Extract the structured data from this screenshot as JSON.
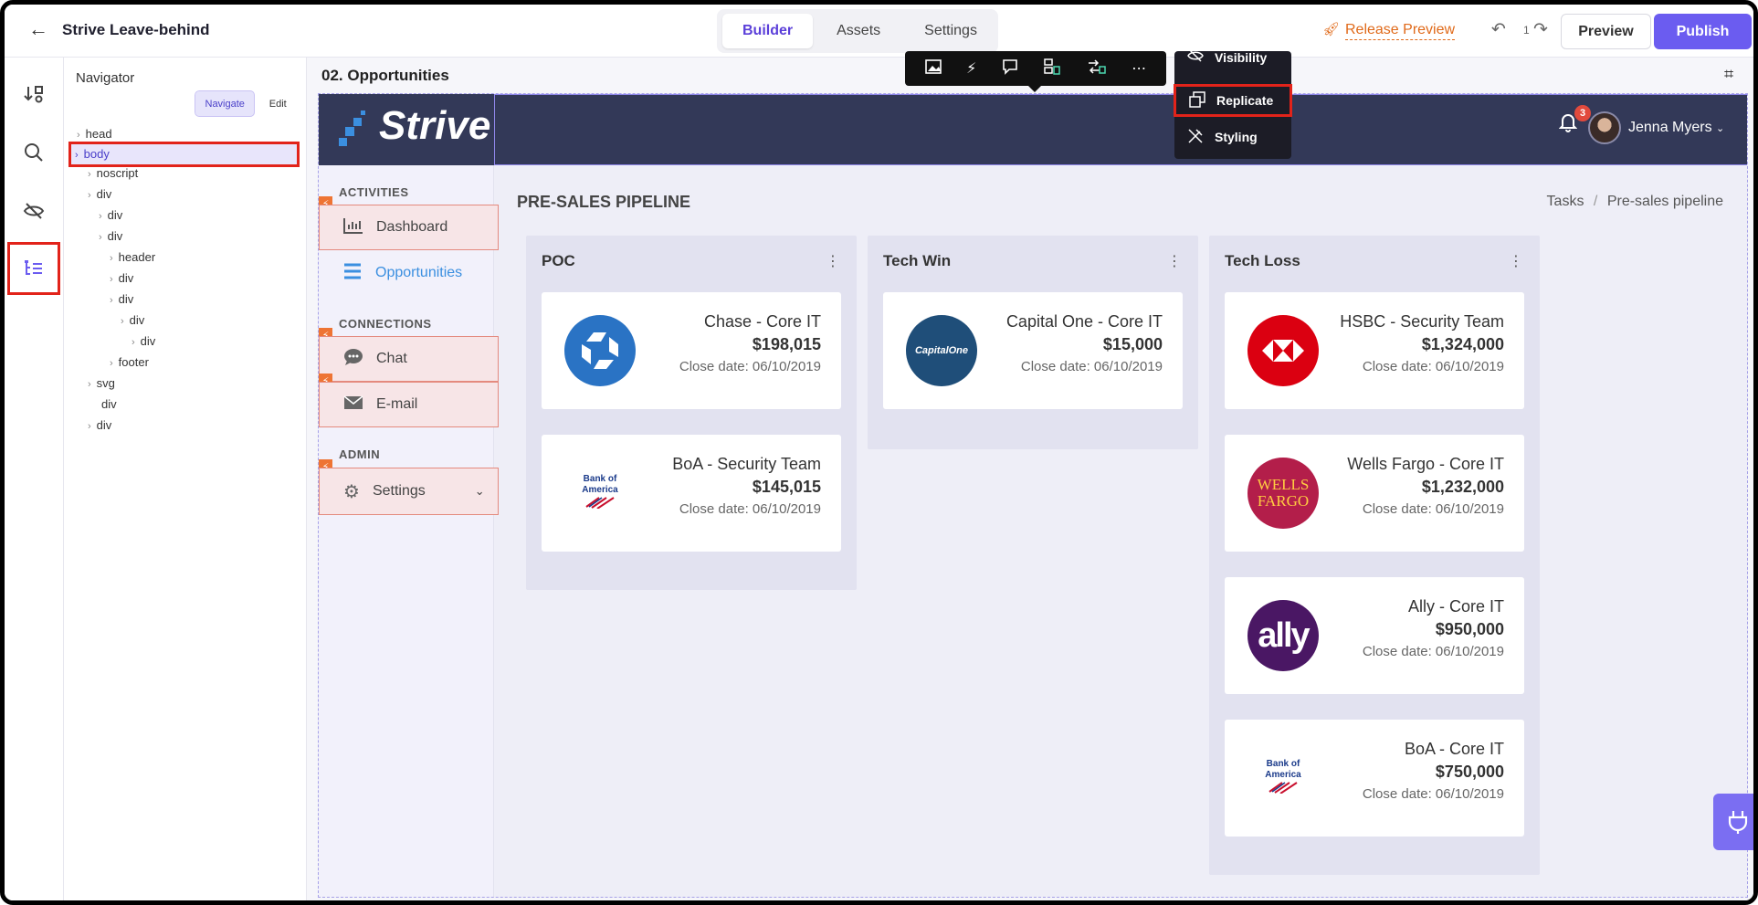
{
  "app": {
    "title": "Strive Leave-behind"
  },
  "top_tabs": [
    {
      "label": "Builder"
    },
    {
      "label": "Assets"
    },
    {
      "label": "Settings"
    }
  ],
  "toolbar": {
    "release_preview": "Release Preview",
    "history_count": "1",
    "preview_label": "Preview",
    "publish_label": "Publish"
  },
  "navigator": {
    "title": "Navigator",
    "mode_navigate": "Navigate",
    "mode_edit": "Edit",
    "tree": [
      {
        "label": "head"
      },
      {
        "label": "body"
      },
      {
        "label": "noscript"
      },
      {
        "label": "div"
      },
      {
        "label": "div"
      },
      {
        "label": "div"
      },
      {
        "label": "header"
      },
      {
        "label": "div"
      },
      {
        "label": "div"
      },
      {
        "label": "div"
      },
      {
        "label": "div"
      },
      {
        "label": "footer"
      },
      {
        "label": "svg"
      },
      {
        "label": "div"
      },
      {
        "label": "div"
      }
    ]
  },
  "canvas": {
    "page_label": "02. Opportunities"
  },
  "context_menu": {
    "visibility": "Visibility",
    "replicate": "Replicate",
    "styling": "Styling"
  },
  "site": {
    "logo_text": "Strive",
    "notifications": "3",
    "user_name": "Jenna Myers",
    "sidebar": {
      "activities": "ACTIVITIES",
      "dashboard": "Dashboard",
      "opportunities": "Opportunities",
      "connections": "CONNECTIONS",
      "chat": "Chat",
      "email": "E-mail",
      "admin": "ADMIN",
      "settings": "Settings"
    },
    "title": "PRE-SALES PIPELINE",
    "breadcrumb": {
      "first": "Tasks",
      "sep": "/",
      "current": "Pre-sales pipeline"
    },
    "columns": [
      {
        "title": "POC",
        "cards": [
          {
            "name": "Chase - Core IT",
            "amount": "$198,015",
            "date": "Close date: 06/10/2019"
          },
          {
            "name": "BoA - Security Team",
            "amount": "$145,015",
            "date": "Close date: 06/10/2019"
          }
        ]
      },
      {
        "title": "Tech Win",
        "cards": [
          {
            "name": "Capital One - Core IT",
            "amount": "$15,000",
            "date": "Close date: 06/10/2019"
          }
        ]
      },
      {
        "title": "Tech Loss",
        "cards": [
          {
            "name": "HSBC - Security Team",
            "amount": "$1,324,000",
            "date": "Close date: 06/10/2019"
          },
          {
            "name": "Wells Fargo - Core IT",
            "amount": "$1,232,000",
            "date": "Close date: 06/10/2019"
          },
          {
            "name": "Ally - Core IT",
            "amount": "$950,000",
            "date": "Close date: 06/10/2019"
          },
          {
            "name": "BoA - Core IT",
            "amount": "$750,000",
            "date": "Close date: 06/10/2019"
          }
        ]
      }
    ],
    "logos": {
      "capital_one": "CapitalOne",
      "bofa": "Bank of America",
      "wells_1": "WELLS",
      "wells_2": "FARGO",
      "ally": "ally"
    }
  },
  "colors": {
    "accent": "#6b5cf0",
    "highlight": "#e2231a",
    "header_bg": "#333958"
  }
}
